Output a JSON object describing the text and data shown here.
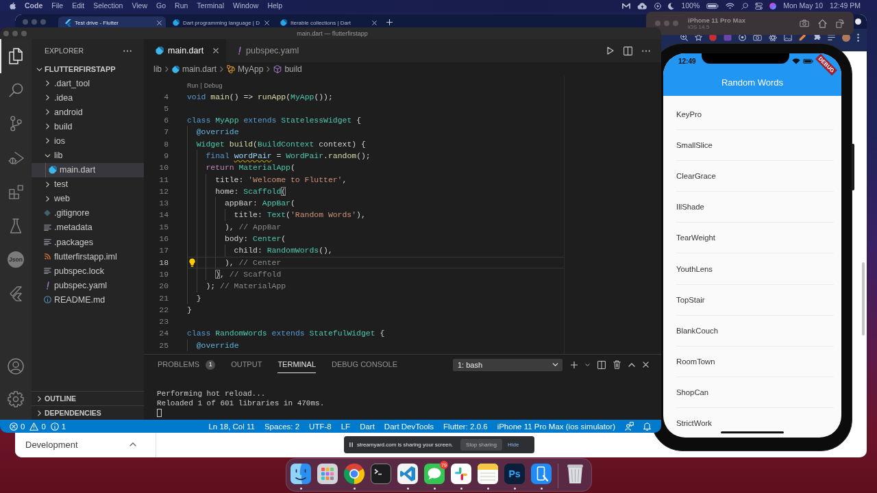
{
  "menu_bar": {
    "app": "Code",
    "menus": [
      "File",
      "Edit",
      "Selection",
      "View",
      "Go",
      "Run",
      "Terminal",
      "Window",
      "Help"
    ],
    "battery": "100%",
    "date": "Mon May 10",
    "time": "12:49 PM"
  },
  "browser": {
    "tabs": [
      {
        "title": "Test drive - Flutter",
        "kind": "flutter",
        "selected": true
      },
      {
        "title": "Dart programming language | D",
        "kind": "dart",
        "selected": false
      },
      {
        "title": "Iterable collections | Dart",
        "kind": "dart",
        "selected": false
      }
    ],
    "nav_item": {
      "label": "Development",
      "expanded": true
    }
  },
  "simulator": {
    "device": "iPhone 11 Pro Max",
    "os": "iOS 14.5",
    "clock": "12:49",
    "banner": "DEBUG",
    "app_title": "Random Words",
    "words": [
      "KeyPro",
      "SmallSlice",
      "ClearGrace",
      "IllShade",
      "TearWeight",
      "YouthLens",
      "TopStair",
      "BlankCouch",
      "RoomTown",
      "ShopCan",
      "StrictWork"
    ]
  },
  "vscode": {
    "title": "main.dart — flutterfirstapp",
    "activity_bar": [
      {
        "kind": "explorer",
        "selected": true
      },
      {
        "kind": "search",
        "selected": false
      },
      {
        "kind": "source-control",
        "selected": false
      },
      {
        "kind": "run-debug",
        "selected": false
      },
      {
        "kind": "extensions",
        "selected": false
      },
      {
        "kind": "testing",
        "selected": false
      },
      {
        "kind": "json",
        "label": "Json",
        "selected": false
      },
      {
        "kind": "flutter",
        "selected": false
      }
    ],
    "activity_bar_bottom": [
      {
        "kind": "accounts"
      },
      {
        "kind": "manage"
      }
    ],
    "explorer": {
      "title": "EXPLORER",
      "root": {
        "label": "FLUTTERFIRSTAPP",
        "expanded": true,
        "children": [
          {
            "label": ".dart_tool",
            "kind": "folder",
            "expanded": false,
            "selected": false
          },
          {
            "label": ".idea",
            "kind": "folder",
            "expanded": false,
            "selected": false
          },
          {
            "label": "android",
            "kind": "folder",
            "expanded": false,
            "selected": false
          },
          {
            "label": "build",
            "kind": "folder",
            "expanded": false,
            "selected": false
          },
          {
            "label": "ios",
            "kind": "folder",
            "expanded": false,
            "selected": false
          },
          {
            "label": "lib",
            "kind": "folder",
            "expanded": true,
            "selected": false,
            "children": [
              {
                "label": "main.dart",
                "kind": "dart",
                "selected": true
              }
            ]
          },
          {
            "label": "test",
            "kind": "folder",
            "expanded": false,
            "selected": false
          },
          {
            "label": "web",
            "kind": "folder",
            "expanded": false,
            "selected": false
          },
          {
            "label": ".gitignore",
            "kind": "git",
            "selected": false
          },
          {
            "label": ".metadata",
            "kind": "text",
            "selected": false
          },
          {
            "label": ".packages",
            "kind": "text",
            "selected": false
          },
          {
            "label": "flutterfirstapp.iml",
            "kind": "feed",
            "selected": false
          },
          {
            "label": "pubspec.lock",
            "kind": "text",
            "selected": false
          },
          {
            "label": "pubspec.yaml",
            "kind": "yaml",
            "selected": false
          },
          {
            "label": "README.md",
            "kind": "info",
            "selected": false
          }
        ]
      },
      "sections": [
        {
          "label": "OUTLINE",
          "expanded": false
        },
        {
          "label": "DEPENDENCIES",
          "expanded": false
        }
      ]
    },
    "tabs": [
      {
        "label": "main.dart",
        "kind": "dart",
        "selected": true
      },
      {
        "label": "pubspec.yaml",
        "kind": "yaml",
        "selected": false
      }
    ],
    "breadcrumb": [
      {
        "label": "lib",
        "kind": "folder"
      },
      {
        "label": "main.dart",
        "kind": "dart"
      },
      {
        "label": "MyApp",
        "kind": "class"
      },
      {
        "label": "build",
        "kind": "method"
      }
    ],
    "codelens": {
      "items": [
        "Run",
        "Debug"
      ],
      "separator": "|"
    },
    "lines": [
      {
        "number": "4",
        "current": false,
        "tokens": [
          {
            "text": "void ",
            "kind": "keyword"
          },
          {
            "text": "main",
            "kind": "function"
          },
          {
            "text": "() => ",
            "kind": "plain"
          },
          {
            "text": "runApp",
            "kind": "function"
          },
          {
            "text": "(",
            "kind": "plain"
          },
          {
            "text": "MyApp",
            "kind": "type"
          },
          {
            "text": "());",
            "kind": "plain"
          }
        ]
      },
      {
        "number": "5",
        "current": false
      },
      {
        "number": "6",
        "current": false,
        "tokens": [
          {
            "text": "class ",
            "kind": "keyword"
          },
          {
            "text": "MyApp ",
            "kind": "type"
          },
          {
            "text": "extends ",
            "kind": "keyword"
          },
          {
            "text": "StatelessWidget ",
            "kind": "type"
          },
          {
            "text": "{",
            "kind": "plain"
          }
        ],
        "children": [
          {
            "number": "7",
            "current": false,
            "tokens": [
              {
                "text": "@override",
                "kind": "annotation"
              }
            ]
          },
          {
            "number": "8",
            "current": false,
            "tokens": [
              {
                "text": "Widget ",
                "kind": "type"
              },
              {
                "text": "build",
                "kind": "function"
              },
              {
                "text": "(",
                "kind": "plain"
              },
              {
                "text": "BuildContext ",
                "kind": "type"
              },
              {
                "text": "context",
                "kind": "param"
              },
              {
                "text": ") {",
                "kind": "plain"
              }
            ],
            "children": [
              {
                "number": "9",
                "current": false,
                "tokens": [
                  {
                    "text": "final ",
                    "kind": "keyword"
                  },
                  {
                    "text": "wordPair",
                    "kind": "unused"
                  },
                  {
                    "text": " = ",
                    "kind": "plain"
                  },
                  {
                    "text": "WordPair",
                    "kind": "type"
                  },
                  {
                    "text": ".",
                    "kind": "plain"
                  },
                  {
                    "text": "random",
                    "kind": "function"
                  },
                  {
                    "text": "();",
                    "kind": "plain"
                  }
                ]
              },
              {
                "number": "10",
                "current": false,
                "tokens": [
                  {
                    "text": "return ",
                    "kind": "control"
                  },
                  {
                    "text": "MaterialApp",
                    "kind": "type"
                  },
                  {
                    "text": "(",
                    "kind": "plain"
                  }
                ],
                "children": [
                  {
                    "number": "11",
                    "current": false,
                    "tokens": [
                      {
                        "text": "title: ",
                        "kind": "plain"
                      },
                      {
                        "text": "'Welcome to Flutter'",
                        "kind": "string"
                      },
                      {
                        "text": ",",
                        "kind": "plain"
                      }
                    ]
                  },
                  {
                    "number": "12",
                    "current": false,
                    "tokens": [
                      {
                        "text": "home: ",
                        "kind": "plain"
                      },
                      {
                        "text": "Scaffold",
                        "kind": "type"
                      },
                      {
                        "text": "(",
                        "kind": "match"
                      }
                    ],
                    "children": [
                      {
                        "number": "13",
                        "current": false,
                        "tokens": [
                          {
                            "text": "appBar: ",
                            "kind": "plain"
                          },
                          {
                            "text": "AppBar",
                            "kind": "type"
                          },
                          {
                            "text": "(",
                            "kind": "plain"
                          }
                        ],
                        "children": [
                          {
                            "number": "14",
                            "current": false,
                            "tokens": [
                              {
                                "text": "title: ",
                                "kind": "plain"
                              },
                              {
                                "text": "Text",
                                "kind": "type"
                              },
                              {
                                "text": "(",
                                "kind": "plain"
                              },
                              {
                                "text": "'Random Words'",
                                "kind": "string"
                              },
                              {
                                "text": "),",
                                "kind": "plain"
                              }
                            ]
                          }
                        ]
                      },
                      {
                        "number": "15",
                        "current": false,
                        "tokens": [
                          {
                            "text": "), ",
                            "kind": "plain"
                          },
                          {
                            "text": "// AppBar",
                            "kind": "label"
                          }
                        ]
                      },
                      {
                        "number": "16",
                        "current": false,
                        "tokens": [
                          {
                            "text": "body: ",
                            "kind": "plain"
                          },
                          {
                            "text": "Center",
                            "kind": "type"
                          },
                          {
                            "text": "(",
                            "kind": "plain"
                          }
                        ],
                        "children": [
                          {
                            "number": "17",
                            "current": false,
                            "tokens": [
                              {
                                "text": "child: ",
                                "kind": "plain"
                              },
                              {
                                "text": "RandomWords",
                                "kind": "type"
                              },
                              {
                                "text": "(),",
                                "kind": "plain"
                              }
                            ]
                          }
                        ]
                      },
                      {
                        "number": "18",
                        "current": true,
                        "tokens": [
                          {
                            "text": "), ",
                            "kind": "plain"
                          },
                          {
                            "text": "// Center",
                            "kind": "label"
                          }
                        ]
                      }
                    ]
                  },
                  {
                    "number": "19",
                    "current": false,
                    "tokens": [
                      {
                        "text": ")",
                        "kind": "match"
                      },
                      {
                        "text": ", ",
                        "kind": "plain"
                      },
                      {
                        "text": "// Scaffold",
                        "kind": "label"
                      }
                    ]
                  }
                ]
              },
              {
                "number": "20",
                "current": false,
                "tokens": [
                  {
                    "text": "); ",
                    "kind": "plain"
                  },
                  {
                    "text": "// MaterialApp",
                    "kind": "label"
                  }
                ]
              }
            ]
          },
          {
            "number": "21",
            "current": false,
            "tokens": [
              {
                "text": "}",
                "kind": "plain"
              }
            ]
          }
        ]
      },
      {
        "number": "22",
        "current": false,
        "tokens": [
          {
            "text": "}",
            "kind": "plain"
          }
        ]
      },
      {
        "number": "23",
        "current": false
      },
      {
        "number": "24",
        "current": false,
        "tokens": [
          {
            "text": "class ",
            "kind": "keyword"
          },
          {
            "text": "RandomWords ",
            "kind": "type"
          },
          {
            "text": "extends ",
            "kind": "keyword"
          },
          {
            "text": "StatefulWidget ",
            "kind": "type"
          },
          {
            "text": "{",
            "kind": "plain"
          }
        ],
        "children": [
          {
            "number": "25",
            "current": false,
            "tokens": [
              {
                "text": "@override",
                "kind": "annotation"
              }
            ]
          }
        ]
      }
    ],
    "panel": {
      "tabs": [
        {
          "label": "PROBLEMS",
          "badge": "1",
          "selected": false
        },
        {
          "label": "OUTPUT",
          "selected": false
        },
        {
          "label": "TERMINAL",
          "selected": true
        },
        {
          "label": "DEBUG CONSOLE",
          "selected": false
        }
      ],
      "terminal": "1: bash",
      "output": [
        "Performing hot reload...",
        "Reloaded 1 of 601 libraries in 470ms."
      ]
    },
    "status_bar": {
      "errors": "0",
      "warnings": "0",
      "infos": "1",
      "items": [
        "Ln 18, Col 11",
        "Spaces: 2",
        "UTF-8",
        "LF",
        "Dart",
        "Dart DevTools",
        "Flutter: 2.0.6",
        "iPhone 11 Pro Max (ios simulator)"
      ]
    }
  },
  "screen_share": {
    "message": "streamyard.com is sharing your screen.",
    "stop_button": "Stop sharing",
    "hide_link": "Hide"
  },
  "dock": {
    "apps": [
      {
        "kind": "finder",
        "running": true
      },
      {
        "kind": "launchpad",
        "running": false
      },
      {
        "kind": "chrome",
        "running": true
      },
      {
        "kind": "terminal",
        "running": false
      },
      {
        "kind": "vscode",
        "running": true
      },
      {
        "kind": "messages",
        "badge": "79",
        "running": true
      },
      {
        "kind": "slack",
        "running": true
      },
      {
        "kind": "notes",
        "running": true
      },
      {
        "kind": "photoshop",
        "label": "Ps",
        "running": true
      },
      {
        "kind": "simulator",
        "running": true
      },
      {
        "kind": "trash",
        "running": false
      }
    ]
  }
}
